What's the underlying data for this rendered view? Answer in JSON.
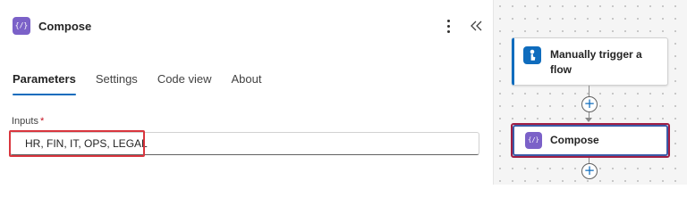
{
  "panel": {
    "action_icon_glyph": "{/}",
    "title": "Compose",
    "tabs": [
      {
        "label": "Parameters",
        "active": true
      },
      {
        "label": "Settings",
        "active": false
      },
      {
        "label": "Code view",
        "active": false
      },
      {
        "label": "About",
        "active": false
      }
    ],
    "inputs": {
      "label": "Inputs",
      "required_mark": "*",
      "value": "HR, FIN, IT, OPS, LEGAL"
    }
  },
  "canvas": {
    "nodes": [
      {
        "label": "Manually trigger a flow",
        "icon": "manual-trigger-icon"
      },
      {
        "label": "Compose",
        "icon": "compose-icon",
        "icon_glyph": "{/}"
      }
    ],
    "add_symbol": "+"
  },
  "colors": {
    "accent": "#0f6cbd",
    "compose_icon": "#7b61c8",
    "highlight_red": "#d9363e",
    "selected_node_border": "#3b5ba8"
  }
}
